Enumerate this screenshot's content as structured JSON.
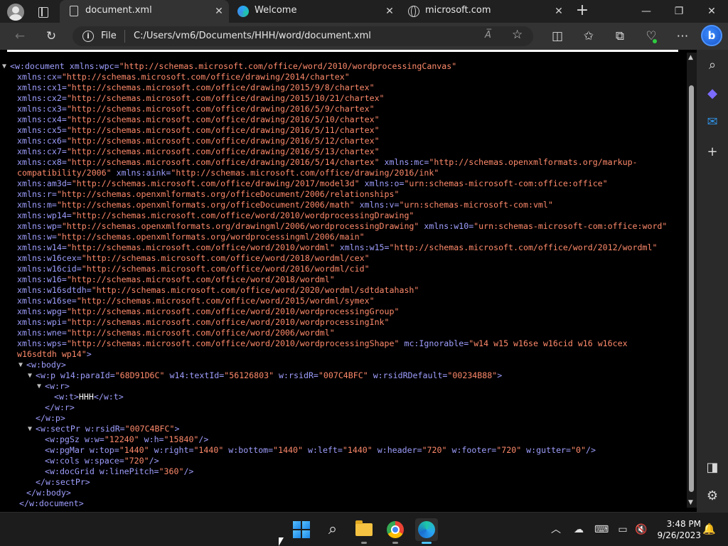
{
  "browser": {
    "tabs": [
      {
        "title": "document.xml",
        "active": true,
        "icon": "document-icon"
      },
      {
        "title": "Welcome",
        "active": false,
        "icon": "edge-icon"
      },
      {
        "title": "microsoft.com",
        "active": false,
        "icon": "globe-icon"
      }
    ],
    "new_tab": "+",
    "address": {
      "scheme_label": "File",
      "url": "C:/Users/vm6/Documents/HHH/word/document.xml",
      "read_aloud": "A̅"
    },
    "bing_label": "b"
  },
  "xml_lines": [
    [
      {
        "t": "<w:document ",
        "c": "tg"
      },
      {
        "t": "xmlns:wpc=",
        "c": "an"
      },
      {
        "t": "\"http://schemas.microsoft.com/office/word/2010/wordprocessingCanvas\"",
        "c": "av"
      }
    ],
    [
      {
        "t": "xmlns:cx=",
        "c": "an"
      },
      {
        "t": "\"http://schemas.microsoft.com/office/drawing/2014/chartex\"",
        "c": "av"
      }
    ],
    [
      {
        "t": "xmlns:cx1=",
        "c": "an"
      },
      {
        "t": "\"http://schemas.microsoft.com/office/drawing/2015/9/8/chartex\"",
        "c": "av"
      }
    ],
    [
      {
        "t": "xmlns:cx2=",
        "c": "an"
      },
      {
        "t": "\"http://schemas.microsoft.com/office/drawing/2015/10/21/chartex\"",
        "c": "av"
      }
    ],
    [
      {
        "t": "xmlns:cx3=",
        "c": "an"
      },
      {
        "t": "\"http://schemas.microsoft.com/office/drawing/2016/5/9/chartex\"",
        "c": "av"
      }
    ],
    [
      {
        "t": "xmlns:cx4=",
        "c": "an"
      },
      {
        "t": "\"http://schemas.microsoft.com/office/drawing/2016/5/10/chartex\"",
        "c": "av"
      }
    ],
    [
      {
        "t": "xmlns:cx5=",
        "c": "an"
      },
      {
        "t": "\"http://schemas.microsoft.com/office/drawing/2016/5/11/chartex\"",
        "c": "av"
      }
    ],
    [
      {
        "t": "xmlns:cx6=",
        "c": "an"
      },
      {
        "t": "\"http://schemas.microsoft.com/office/drawing/2016/5/12/chartex\"",
        "c": "av"
      }
    ],
    [
      {
        "t": "xmlns:cx7=",
        "c": "an"
      },
      {
        "t": "\"http://schemas.microsoft.com/office/drawing/2016/5/13/chartex\"",
        "c": "av"
      }
    ],
    [
      {
        "t": "xmlns:cx8=",
        "c": "an"
      },
      {
        "t": "\"http://schemas.microsoft.com/office/drawing/2016/5/14/chartex\"",
        "c": "av"
      },
      {
        "t": " xmlns:mc=",
        "c": "an"
      },
      {
        "t": "\"http://schemas.openxmlformats.org/markup-",
        "c": "av"
      }
    ],
    [
      {
        "t": "compatibility/2006\"",
        "c": "av"
      },
      {
        "t": " xmlns:aink=",
        "c": "an"
      },
      {
        "t": "\"http://schemas.microsoft.com/office/drawing/2016/ink\"",
        "c": "av"
      }
    ],
    [
      {
        "t": "xmlns:am3d=",
        "c": "an"
      },
      {
        "t": "\"http://schemas.microsoft.com/office/drawing/2017/model3d\"",
        "c": "av"
      },
      {
        "t": " xmlns:o=",
        "c": "an"
      },
      {
        "t": "\"urn:schemas-microsoft-com:office:office\"",
        "c": "av"
      }
    ],
    [
      {
        "t": "xmlns:r=",
        "c": "an"
      },
      {
        "t": "\"http://schemas.openxmlformats.org/officeDocument/2006/relationships\"",
        "c": "av"
      }
    ],
    [
      {
        "t": "xmlns:m=",
        "c": "an"
      },
      {
        "t": "\"http://schemas.openxmlformats.org/officeDocument/2006/math\"",
        "c": "av"
      },
      {
        "t": " xmlns:v=",
        "c": "an"
      },
      {
        "t": "\"urn:schemas-microsoft-com:vml\"",
        "c": "av"
      }
    ],
    [
      {
        "t": "xmlns:wp14=",
        "c": "an"
      },
      {
        "t": "\"http://schemas.microsoft.com/office/word/2010/wordprocessingDrawing\"",
        "c": "av"
      }
    ],
    [
      {
        "t": "xmlns:wp=",
        "c": "an"
      },
      {
        "t": "\"http://schemas.openxmlformats.org/drawingml/2006/wordprocessingDrawing\"",
        "c": "av"
      },
      {
        "t": " xmlns:w10=",
        "c": "an"
      },
      {
        "t": "\"urn:schemas-microsoft-com:office:word\"",
        "c": "av"
      }
    ],
    [
      {
        "t": "xmlns:w=",
        "c": "an"
      },
      {
        "t": "\"http://schemas.openxmlformats.org/wordprocessingml/2006/main\"",
        "c": "av"
      }
    ],
    [
      {
        "t": "xmlns:w14=",
        "c": "an"
      },
      {
        "t": "\"http://schemas.microsoft.com/office/word/2010/wordml\"",
        "c": "av"
      },
      {
        "t": " xmlns:w15=",
        "c": "an"
      },
      {
        "t": "\"http://schemas.microsoft.com/office/word/2012/wordml\"",
        "c": "av"
      }
    ],
    [
      {
        "t": "xmlns:w16cex=",
        "c": "an"
      },
      {
        "t": "\"http://schemas.microsoft.com/office/word/2018/wordml/cex\"",
        "c": "av"
      }
    ],
    [
      {
        "t": "xmlns:w16cid=",
        "c": "an"
      },
      {
        "t": "\"http://schemas.microsoft.com/office/word/2016/wordml/cid\"",
        "c": "av"
      }
    ],
    [
      {
        "t": "xmlns:w16=",
        "c": "an"
      },
      {
        "t": "\"http://schemas.microsoft.com/office/word/2018/wordml\"",
        "c": "av"
      }
    ],
    [
      {
        "t": "xmlns:w16sdtdh=",
        "c": "an"
      },
      {
        "t": "\"http://schemas.microsoft.com/office/word/2020/wordml/sdtdatahash\"",
        "c": "av"
      }
    ],
    [
      {
        "t": "xmlns:w16se=",
        "c": "an"
      },
      {
        "t": "\"http://schemas.microsoft.com/office/word/2015/wordml/symex\"",
        "c": "av"
      }
    ],
    [
      {
        "t": "xmlns:wpg=",
        "c": "an"
      },
      {
        "t": "\"http://schemas.microsoft.com/office/word/2010/wordprocessingGroup\"",
        "c": "av"
      }
    ],
    [
      {
        "t": "xmlns:wpi=",
        "c": "an"
      },
      {
        "t": "\"http://schemas.microsoft.com/office/word/2010/wordprocessingInk\"",
        "c": "av"
      }
    ],
    [
      {
        "t": "xmlns:wne=",
        "c": "an"
      },
      {
        "t": "\"http://schemas.microsoft.com/office/word/2006/wordml\"",
        "c": "av"
      }
    ],
    [
      {
        "t": "xmlns:wps=",
        "c": "an"
      },
      {
        "t": "\"http://schemas.microsoft.com/office/word/2010/wordprocessingShape\"",
        "c": "av"
      },
      {
        "t": " mc:Ignorable=",
        "c": "an"
      },
      {
        "t": "\"w14 w15 w16se w16cid w16 w16cex",
        "c": "av"
      }
    ],
    [
      {
        "t": "w16sdtdh wp14\"",
        "c": "av"
      },
      {
        "t": ">",
        "c": "tg"
      }
    ],
    [
      {
        "t": "<w:body>",
        "c": "tg"
      }
    ],
    [
      {
        "t": "<w:p ",
        "c": "tg"
      },
      {
        "t": "w14:paraId=",
        "c": "an"
      },
      {
        "t": "\"68D91D6C\"",
        "c": "av"
      },
      {
        "t": " w14:textId=",
        "c": "an"
      },
      {
        "t": "\"56126803\"",
        "c": "av"
      },
      {
        "t": " w:rsidR=",
        "c": "an"
      },
      {
        "t": "\"007C4BFC\"",
        "c": "av"
      },
      {
        "t": " w:rsidRDefault=",
        "c": "an"
      },
      {
        "t": "\"00234B88\"",
        "c": "av"
      },
      {
        "t": ">",
        "c": "tg"
      }
    ],
    [
      {
        "t": "<w:r>",
        "c": "tg"
      }
    ],
    [
      {
        "t": "<w:t>",
        "c": "tg"
      },
      {
        "t": "HHH",
        "c": "tx"
      },
      {
        "t": "</w:t>",
        "c": "tg"
      }
    ],
    [
      {
        "t": "</w:r>",
        "c": "tg"
      }
    ],
    [
      {
        "t": "</w:p>",
        "c": "tg"
      }
    ],
    [
      {
        "t": "<w:sectPr ",
        "c": "tg"
      },
      {
        "t": "w:rsidR=",
        "c": "an"
      },
      {
        "t": "\"007C4BFC\"",
        "c": "av"
      },
      {
        "t": ">",
        "c": "tg"
      }
    ],
    [
      {
        "t": "<w:pgSz ",
        "c": "tg"
      },
      {
        "t": "w:w=",
        "c": "an"
      },
      {
        "t": "\"12240\"",
        "c": "av"
      },
      {
        "t": " w:h=",
        "c": "an"
      },
      {
        "t": "\"15840\"",
        "c": "av"
      },
      {
        "t": "/>",
        "c": "tg"
      }
    ],
    [
      {
        "t": "<w:pgMar ",
        "c": "tg"
      },
      {
        "t": "w:top=",
        "c": "an"
      },
      {
        "t": "\"1440\"",
        "c": "av"
      },
      {
        "t": " w:right=",
        "c": "an"
      },
      {
        "t": "\"1440\"",
        "c": "av"
      },
      {
        "t": " w:bottom=",
        "c": "an"
      },
      {
        "t": "\"1440\"",
        "c": "av"
      },
      {
        "t": " w:left=",
        "c": "an"
      },
      {
        "t": "\"1440\"",
        "c": "av"
      },
      {
        "t": " w:header=",
        "c": "an"
      },
      {
        "t": "\"720\"",
        "c": "av"
      },
      {
        "t": " w:footer=",
        "c": "an"
      },
      {
        "t": "\"720\"",
        "c": "av"
      },
      {
        "t": " w:gutter=",
        "c": "an"
      },
      {
        "t": "\"0\"",
        "c": "av"
      },
      {
        "t": "/>",
        "c": "tg"
      }
    ],
    [
      {
        "t": "<w:cols ",
        "c": "tg"
      },
      {
        "t": "w:space=",
        "c": "an"
      },
      {
        "t": "\"720\"",
        "c": "av"
      },
      {
        "t": "/>",
        "c": "tg"
      }
    ],
    [
      {
        "t": "<w:docGrid ",
        "c": "tg"
      },
      {
        "t": "w:linePitch=",
        "c": "an"
      },
      {
        "t": "\"360\"",
        "c": "av"
      },
      {
        "t": "/>",
        "c": "tg"
      }
    ],
    [
      {
        "t": "</w:sectPr>",
        "c": "tg"
      }
    ],
    [
      {
        "t": "</w:body>",
        "c": "tg"
      }
    ],
    [
      {
        "t": "</w:document>",
        "c": "tg"
      }
    ]
  ],
  "xml_indent": [
    0,
    1,
    1,
    1,
    1,
    1,
    1,
    1,
    1,
    1,
    1,
    1,
    1,
    1,
    1,
    1,
    1,
    1,
    1,
    1,
    1,
    1,
    1,
    1,
    1,
    1,
    1,
    1,
    2,
    3,
    4,
    5,
    4,
    3,
    3,
    4,
    4,
    4,
    4,
    3,
    2,
    1
  ],
  "xml_toggles": {
    "0": "▼",
    "28": "▼",
    "29": "▼",
    "30": "▼",
    "34": "▼"
  },
  "taskbar": {
    "clock_time": "3:48 PM",
    "clock_date": "9/26/2023"
  }
}
